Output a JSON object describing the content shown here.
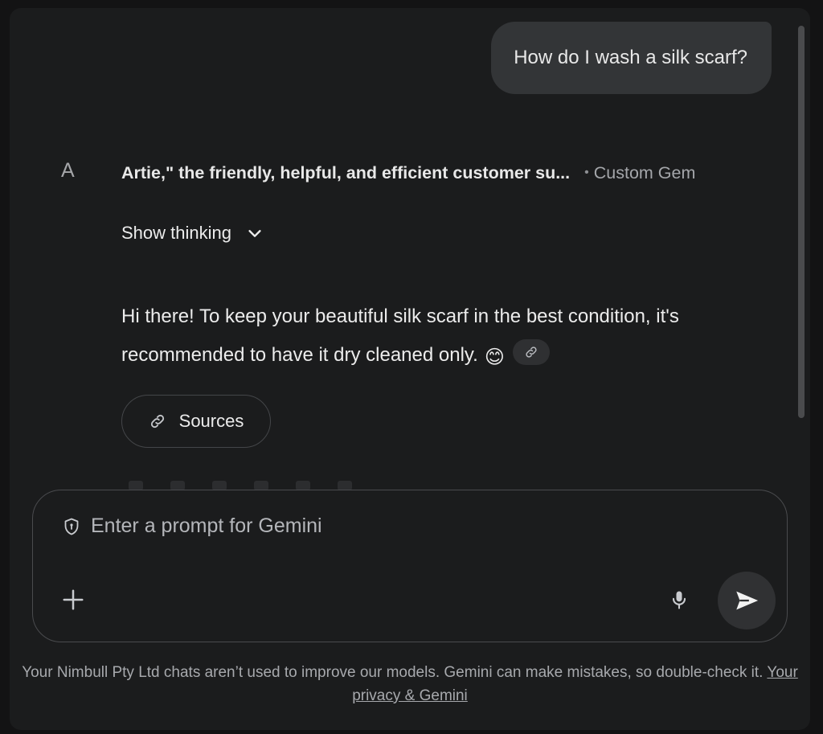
{
  "conversation": {
    "user_message": "How do I wash a silk scarf?",
    "avatar_letter": "A",
    "gem_name": "Artie,\" the friendly, helpful, and efficient customer su...",
    "gem_separator": "•",
    "gem_tag": "Custom Gem",
    "show_thinking_label": "Show thinking",
    "answer_text": "Hi there! To keep your beautiful silk scarf in the best condition, it's recommended to have it dry cleaned only.",
    "answer_emoji": "😊",
    "sources_label": "Sources"
  },
  "composer": {
    "placeholder": "Enter a prompt for Gemini",
    "icons": [
      "shield-icon",
      "plus-icon",
      "microphone-icon",
      "send-icon"
    ]
  },
  "footer": {
    "disclaimer": "Your Nimbull Pty Ltd chats aren’t used to improve our models. Gemini can make mistakes, so double-check it.",
    "privacy_link": "Your privacy & Gemini"
  },
  "colors": {
    "background": "#1b1c1d",
    "user_bubble": "#333537",
    "text": "#ececec",
    "muted": "#a7a9ad"
  }
}
